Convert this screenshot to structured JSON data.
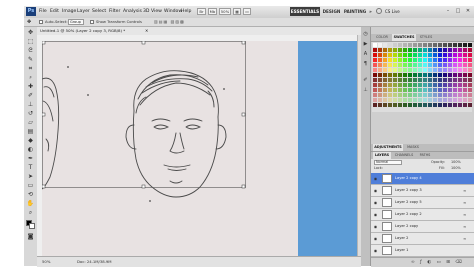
{
  "app": {
    "logo": "Ps",
    "menus": [
      "File",
      "Edit",
      "Image",
      "Layer",
      "Select",
      "Filter",
      "Analysis",
      "3D",
      "View",
      "Window",
      "Help"
    ],
    "zoom_display": "50%",
    "workspaces": [
      "ESSENTIALS",
      "DESIGN",
      "PAINTING"
    ],
    "workspace_more": "»",
    "cs_live": "CS Live"
  },
  "options_bar": {
    "auto_select_label": "Auto-Select:",
    "auto_select_value": "Group",
    "transform_controls_label": "Show Transform Controls"
  },
  "document": {
    "tab_label": "Untitled-1 @ 50% (Layer 2 copy 3, RGB/8) *",
    "zoom": "50%",
    "doc_info": "Doc: 24.1M/38.9M",
    "canvas_color": "#e8e2e2",
    "blue_layer_color": "#5b9bd5"
  },
  "panels": {
    "top_tabs": [
      "COLOR",
      "SWATCHES",
      "STYLES"
    ],
    "active_top_tab": "SWATCHES",
    "mid_tabs": [
      "ADJUSTMENTS",
      "MASKS"
    ],
    "layer_tabs": [
      "LAYERS",
      "CHANNELS",
      "PATHS"
    ],
    "blend_mode": "Normal",
    "opacity_label": "Opacity:",
    "opacity_value": "100%",
    "lock_label": "Lock:",
    "fill_label": "Fill:",
    "fill_value": "100%"
  },
  "layers": [
    {
      "name": "Layer 2 copy 4",
      "selected": true
    },
    {
      "name": "Layer 2 copy 3",
      "selected": false
    },
    {
      "name": "Layer 2 copy 5",
      "selected": false
    },
    {
      "name": "Layer 2 copy 2",
      "selected": false
    },
    {
      "name": "Layer 2 copy",
      "selected": false
    },
    {
      "name": "Layer 2",
      "selected": false
    },
    {
      "name": "Layer 1",
      "selected": false
    }
  ],
  "icons": {
    "move_tool": "move-icon",
    "eye": "eye-icon",
    "chain": "link-icon"
  },
  "colors": {
    "selection_blue": "#4f7ed9",
    "workspace_active": "#3d3d3d"
  }
}
